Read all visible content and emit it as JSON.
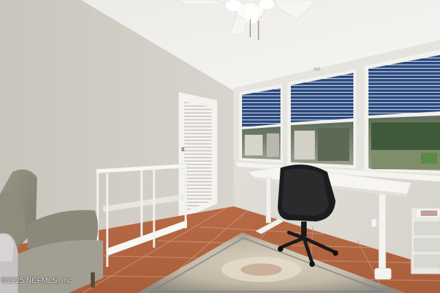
{
  "photo": {
    "watermark": "©2025 NEFMLS, Inc"
  },
  "palette": {
    "wall_left": "#d2cec5",
    "wall_right": "#dedbd5",
    "ceiling": "#efeeea",
    "floor_tile": "#b56a45",
    "grout": "#c79a7e",
    "window_glass": "#2a4f86",
    "desk_white": "#f2f1ee",
    "chair_black": "#1c1c1e",
    "armchair": "#8d8a7c",
    "rug": "#c9bfae"
  }
}
